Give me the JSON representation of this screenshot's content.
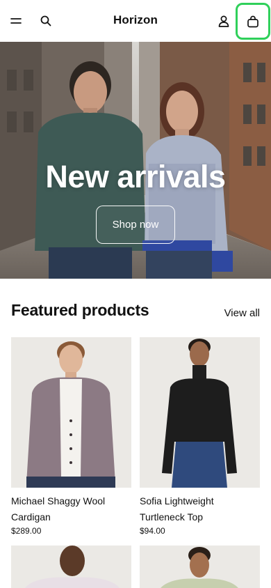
{
  "header": {
    "logo": "Horizon",
    "icons": {
      "menu": "hamburger-icon",
      "search": "search-icon",
      "account": "user-icon",
      "cart": "shopping-bag-icon"
    },
    "highlight_color": "#2fd05a"
  },
  "hero": {
    "title": "New arrivals",
    "cta_label": "Shop now"
  },
  "featured": {
    "title": "Featured products",
    "view_all_label": "View all",
    "products": [
      {
        "name": "Michael Shaggy Wool Cardigan",
        "price": "$289.00"
      },
      {
        "name": "Sofia Lightweight Turtleneck Top",
        "price": "$94.00"
      }
    ]
  }
}
